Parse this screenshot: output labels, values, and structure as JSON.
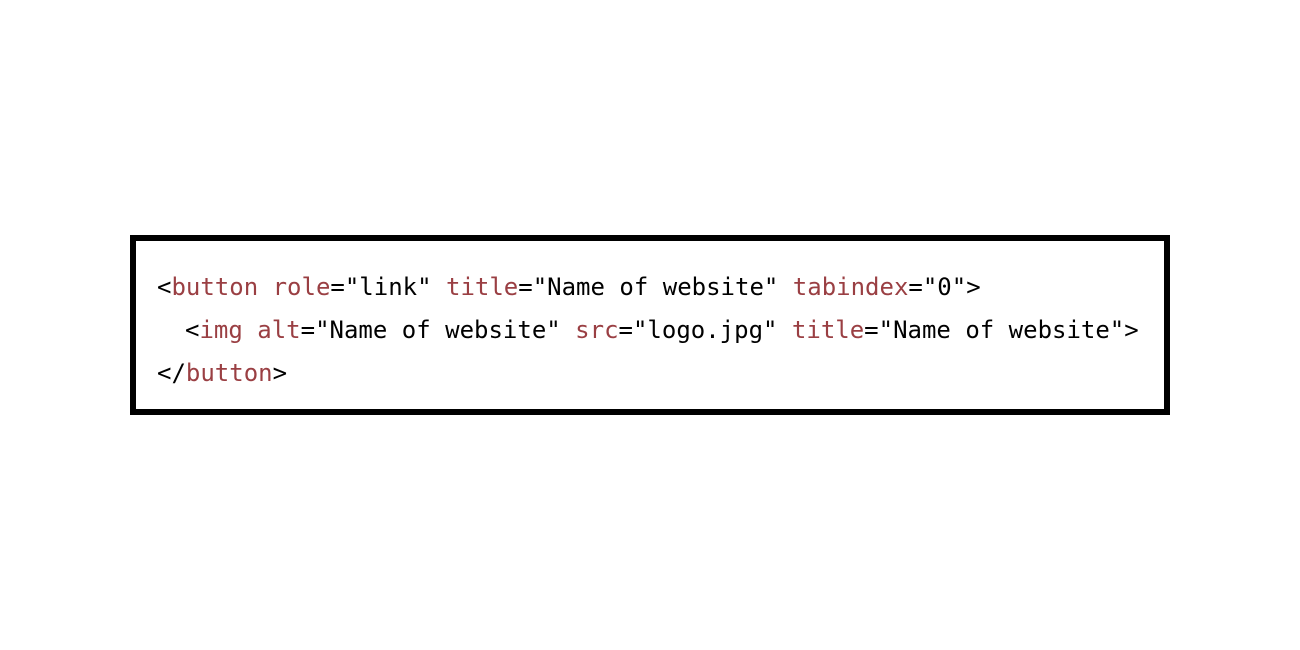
{
  "colors": {
    "tag": "#9a3f43",
    "attr": "#9a3f43",
    "punct": "#000000",
    "value": "#000000",
    "border": "#000000",
    "background": "#ffffff"
  },
  "lines": [
    {
      "indent": false,
      "tokens": [
        {
          "text": "<",
          "kind": "punct"
        },
        {
          "text": "button",
          "kind": "tag"
        },
        {
          "text": " ",
          "kind": "punct"
        },
        {
          "text": "role",
          "kind": "attr"
        },
        {
          "text": "=\"link\" ",
          "kind": "value"
        },
        {
          "text": "title",
          "kind": "attr"
        },
        {
          "text": "=\"Name of website\" ",
          "kind": "value"
        },
        {
          "text": "tabindex",
          "kind": "attr"
        },
        {
          "text": "=\"0\">",
          "kind": "value"
        }
      ]
    },
    {
      "indent": true,
      "tokens": [
        {
          "text": "<",
          "kind": "punct"
        },
        {
          "text": "img",
          "kind": "tag"
        },
        {
          "text": " ",
          "kind": "punct"
        },
        {
          "text": "alt",
          "kind": "attr"
        },
        {
          "text": "=\"Name of website\" ",
          "kind": "value"
        },
        {
          "text": "src",
          "kind": "attr"
        },
        {
          "text": "=\"logo.jpg\" ",
          "kind": "value"
        },
        {
          "text": "title",
          "kind": "attr"
        },
        {
          "text": "=\"Name of website\">",
          "kind": "value"
        }
      ]
    },
    {
      "indent": false,
      "tokens": [
        {
          "text": "</",
          "kind": "punct"
        },
        {
          "text": "button",
          "kind": "tag"
        },
        {
          "text": ">",
          "kind": "punct"
        }
      ]
    }
  ]
}
